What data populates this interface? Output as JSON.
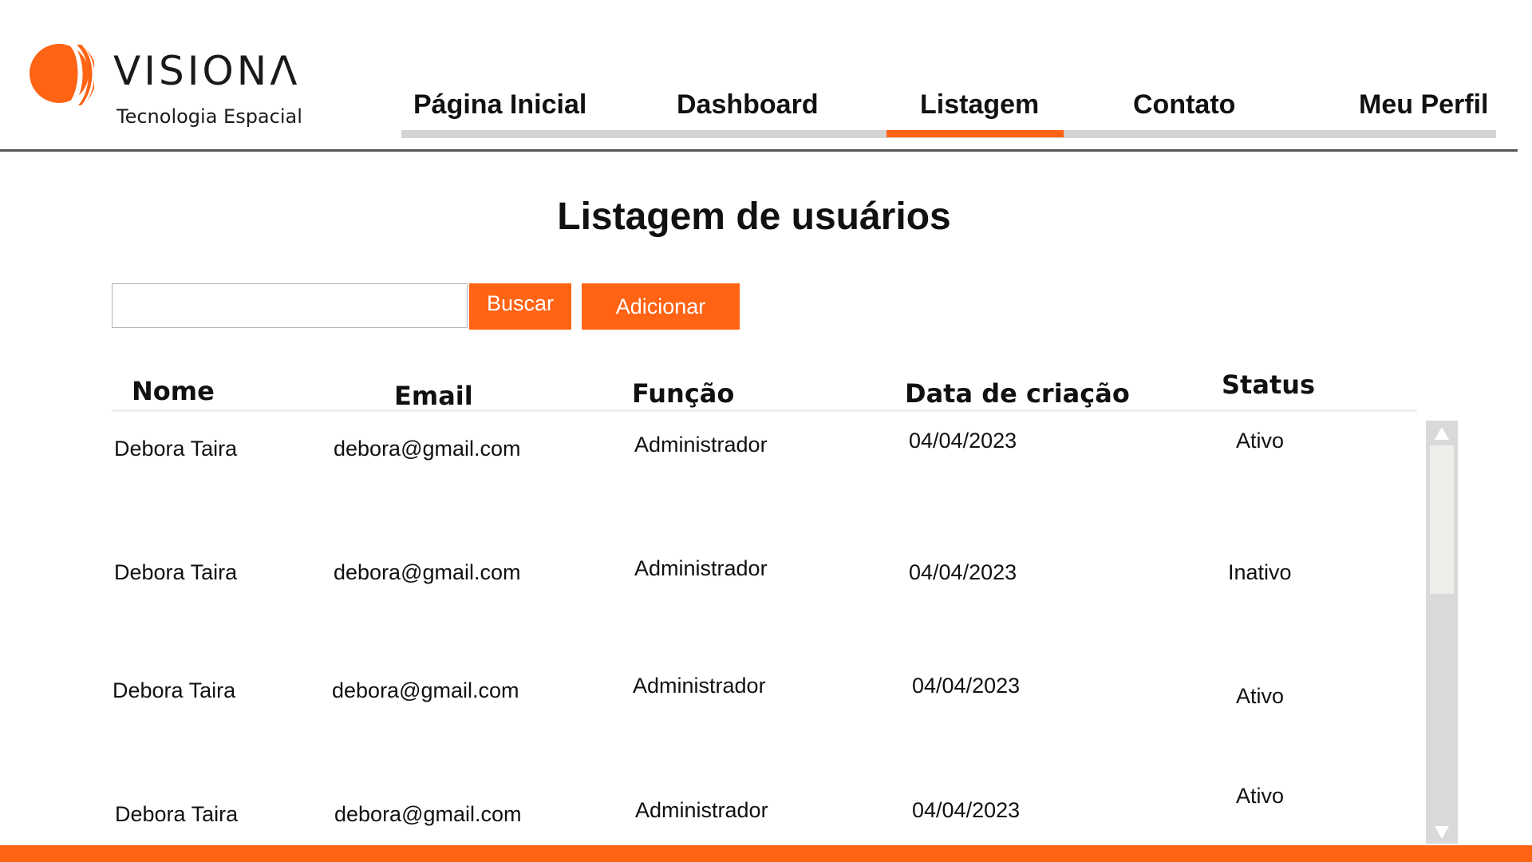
{
  "brand": {
    "name": "VISIONΛ",
    "tagline": "Tecnologia Espacial",
    "accent_color": "#ff6314"
  },
  "nav": {
    "items": [
      {
        "label": "Página Inicial",
        "active": false
      },
      {
        "label": "Dashboard",
        "active": false
      },
      {
        "label": "Listagem",
        "active": true
      },
      {
        "label": "Contato",
        "active": false
      },
      {
        "label": "Meu Perfil",
        "active": false
      }
    ]
  },
  "page": {
    "title": "Listagem de usuários"
  },
  "search": {
    "value": "",
    "placeholder": "",
    "button_label": "Buscar"
  },
  "actions": {
    "add_label": "Adicionar"
  },
  "table": {
    "columns": [
      "Nome",
      "Email",
      "Função",
      "Data de criação",
      "Status"
    ],
    "rows": [
      {
        "name": "Debora Taira",
        "email": "debora@gmail.com",
        "role": "Administrador",
        "created": "04/04/2023",
        "status": "Ativo"
      },
      {
        "name": "Debora Taira",
        "email": "debora@gmail.com",
        "role": "Administrador",
        "created": "04/04/2023",
        "status": "Inativo"
      },
      {
        "name": "Debora Taira",
        "email": "debora@gmail.com",
        "role": "Administrador",
        "created": "04/04/2023",
        "status": "Ativo"
      },
      {
        "name": "Debora Taira",
        "email": "debora@gmail.com",
        "role": "Administrador",
        "created": "04/04/2023",
        "status": "Ativo"
      }
    ]
  },
  "icons": {
    "logo": "visiona-logo-icon",
    "scroll_up": "arrow-up-icon",
    "scroll_down": "arrow-down-icon"
  }
}
